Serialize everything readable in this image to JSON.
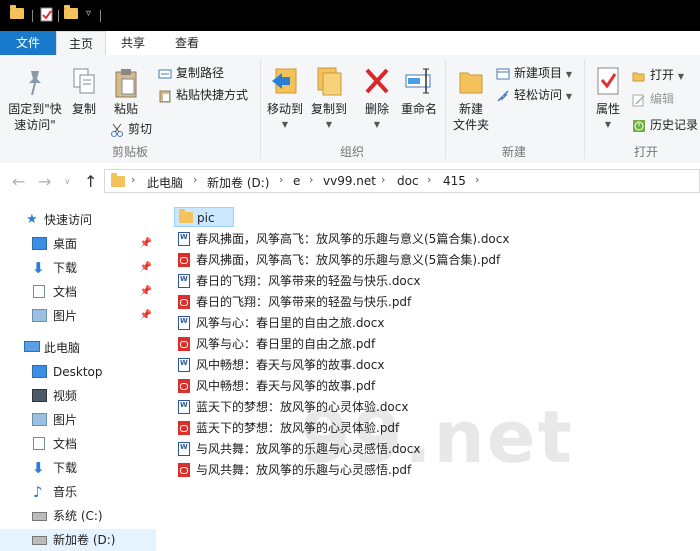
{
  "ribbon_tabs": {
    "file": "文件",
    "home": "主页",
    "share": "共享",
    "view": "查看"
  },
  "ribbon": {
    "clipboard": {
      "pin_quick_access_line1": "固定到\"快",
      "pin_quick_access_line2": "速访问\"",
      "copy": "复制",
      "paste": "粘贴",
      "copy_path": "复制路径",
      "paste_shortcut": "粘贴快捷方式",
      "cut": "剪切",
      "group_label": "剪贴板"
    },
    "organize": {
      "move_to": "移动到",
      "copy_to": "复制到",
      "delete": "删除",
      "rename": "重命名",
      "group_label": "组织"
    },
    "new": {
      "new_folder_line1": "新建",
      "new_folder_line2": "文件夹",
      "new_item": "新建项目",
      "easy_access": "轻松访问",
      "group_label": "新建"
    },
    "open": {
      "properties": "属性",
      "open": "打开",
      "edit": "编辑",
      "history": "历史记录",
      "group_label": "打开"
    }
  },
  "breadcrumb": [
    "此电脑",
    "新加卷 (D:)",
    "e",
    "vv99.net",
    "doc",
    "415"
  ],
  "nav_pane": {
    "quick_access": "快速访问",
    "quick_items": [
      "桌面",
      "下载",
      "文档",
      "图片"
    ],
    "this_pc": "此电脑",
    "pc_items": [
      "Desktop",
      "视频",
      "图片",
      "文档",
      "下载",
      "音乐",
      "系统 (C:)",
      "新加卷 (D:)"
    ]
  },
  "files": [
    {
      "name": "pic",
      "type": "folder"
    },
    {
      "name": "春风拂面，风筝高飞：放风筝的乐趣与意义(5篇合集).docx",
      "type": "docx"
    },
    {
      "name": "春风拂面，风筝高飞：放风筝的乐趣与意义(5篇合集).pdf",
      "type": "pdf"
    },
    {
      "name": "春日的飞翔：风筝带来的轻盈与快乐.docx",
      "type": "docx"
    },
    {
      "name": "春日的飞翔：风筝带来的轻盈与快乐.pdf",
      "type": "pdf"
    },
    {
      "name": "风筝与心：春日里的自由之旅.docx",
      "type": "docx"
    },
    {
      "name": "风筝与心：春日里的自由之旅.pdf",
      "type": "pdf"
    },
    {
      "name": "风中畅想：春天与风筝的故事.docx",
      "type": "docx"
    },
    {
      "name": "风中畅想：春天与风筝的故事.pdf",
      "type": "pdf"
    },
    {
      "name": "蓝天下的梦想：放风筝的心灵体验.docx",
      "type": "docx"
    },
    {
      "name": "蓝天下的梦想：放风筝的心灵体验.pdf",
      "type": "pdf"
    },
    {
      "name": "与风共舞：放风筝的乐趣与心灵感悟.docx",
      "type": "docx"
    },
    {
      "name": "与风共舞：放风筝的乐趣与心灵感悟.pdf",
      "type": "pdf"
    }
  ],
  "watermark": "99.net",
  "colors": {
    "accent": "#1979ca",
    "folder": "#f3c25a",
    "selection": "#cce8ff",
    "delete_red": "#d8272d"
  }
}
